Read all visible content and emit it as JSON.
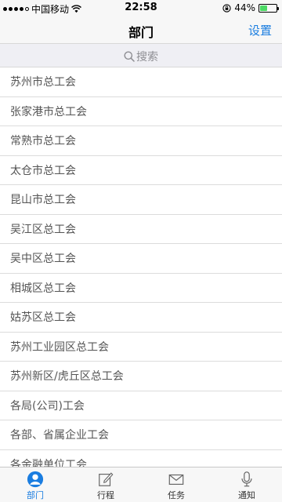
{
  "status_bar": {
    "carrier": "中国移动",
    "time": "22:58",
    "battery_text": "44%",
    "battery_level": 0.44,
    "battery_color": "#4cd964"
  },
  "nav": {
    "title": "部门",
    "action_label": "设置",
    "accent_color": "#1a7de0"
  },
  "search": {
    "placeholder": "搜索",
    "icon": "search-icon"
  },
  "departments": [
    "苏州市总工会",
    "张家港市总工会",
    "常熟市总工会",
    "太仓市总工会",
    "昆山市总工会",
    "吴江区总工会",
    "吴中区总工会",
    "相城区总工会",
    "姑苏区总工会",
    "苏州工业园区总工会",
    "苏州新区/虎丘区总工会",
    "各局(公司)工会",
    "各部、省属企业工会",
    "各金融单位工会"
  ],
  "tabs": [
    {
      "label": "部门",
      "icon": "person-icon",
      "active": true
    },
    {
      "label": "行程",
      "icon": "compose-icon",
      "active": false
    },
    {
      "label": "任务",
      "icon": "mail-icon",
      "active": false
    },
    {
      "label": "通知",
      "icon": "microphone-icon",
      "active": false
    }
  ]
}
